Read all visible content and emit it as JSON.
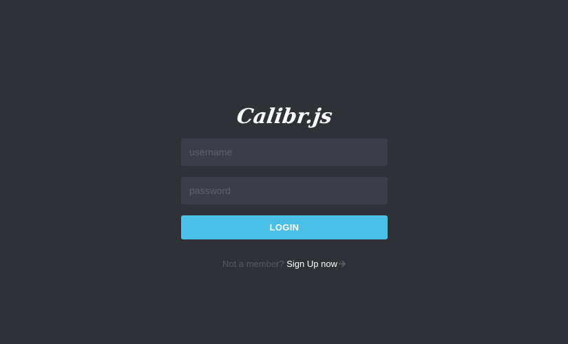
{
  "brand": {
    "logo_text": "Calibr.js"
  },
  "form": {
    "username_placeholder": "username",
    "password_placeholder": "password",
    "login_label": "LOGIN"
  },
  "signup": {
    "prompt": "Not a member?",
    "link_label": "Sign Up now",
    "arrow_icon": "arrow-right-icon"
  },
  "colors": {
    "background": "#2e3136",
    "input_background": "#3b3e49",
    "accent": "#4bbfe6",
    "muted_text": "#565a63"
  }
}
